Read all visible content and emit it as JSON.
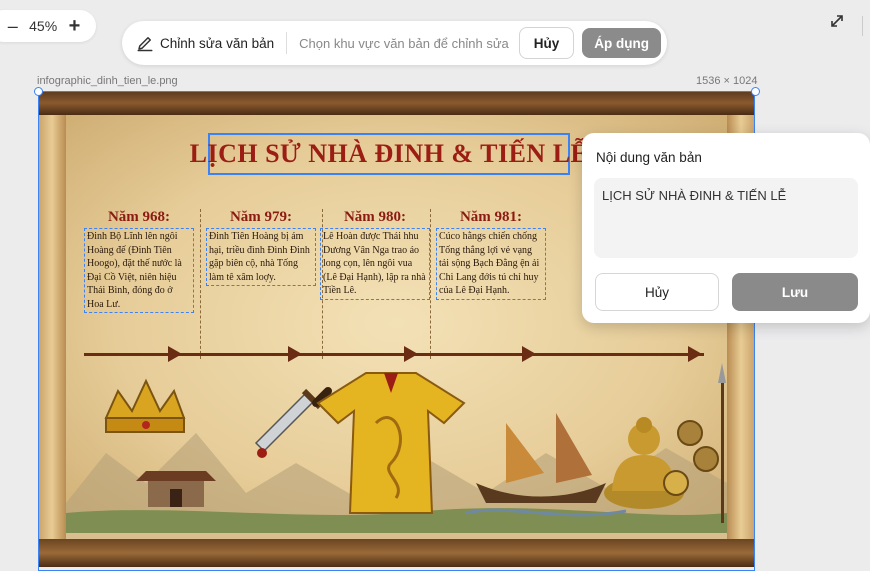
{
  "zoom": {
    "minus": "–",
    "value": "45%",
    "plus": "+"
  },
  "toolbar": {
    "edit_label": "Chỉnh sửa văn bản",
    "hint": "Chọn khu vực văn bản để chỉnh sửa",
    "cancel": "Hủy",
    "apply": "Áp dụng"
  },
  "image": {
    "filename": "infographic_dinh_tien_le.png",
    "dimensions": "1536 × 1024",
    "title": "LỊCH SỬ NHÀ ĐINH & TIẾN LỄ",
    "columns": [
      {
        "year": "Năm 968:",
        "text": "Đinh Bộ Lĩnh lên ngôi Hoàng đế (Đinh Tiên Hoogo), đặt thế nước là Đại Cồ Việt, niên hiệu Thái Bình, đóng đo ở Hoa Lư."
      },
      {
        "year": "Năm 979:",
        "text": "Đinh Tiên Hoàng bị ám hại, triều đình Đình Đinh gặp biên cộ, nhà Tống làm tê xâm loợy."
      },
      {
        "year": "Năm 980:",
        "text": "Lê Hoàn được Thái hhu Dương Vân Nga trao áo long cọn, lên ngôi vua (Lê Đại Hạnh), lập ra nhà Tiền Lê."
      },
      {
        "year": "Năm 981:",
        "text": "Cúco hằngs chiến chống Tống thắng lợi vẻ vạng tải sộng Bạch Đằng ện ải Chi Lang đớis tú chỉ huy của Lê Đại Hạnh."
      }
    ]
  },
  "panel": {
    "heading": "Nội dung văn bản",
    "textarea_value": "LỊCH SỬ NHÀ ĐINH & TIẾN LỄ",
    "cancel": "Hủy",
    "save": "Lưu"
  },
  "colors": {
    "selection": "#3b82f6",
    "apply_bg": "#8b8b8b",
    "title_red": "#9b1d14"
  },
  "icons": {
    "edit": "pencil-icon",
    "expand": "expand-icon"
  }
}
